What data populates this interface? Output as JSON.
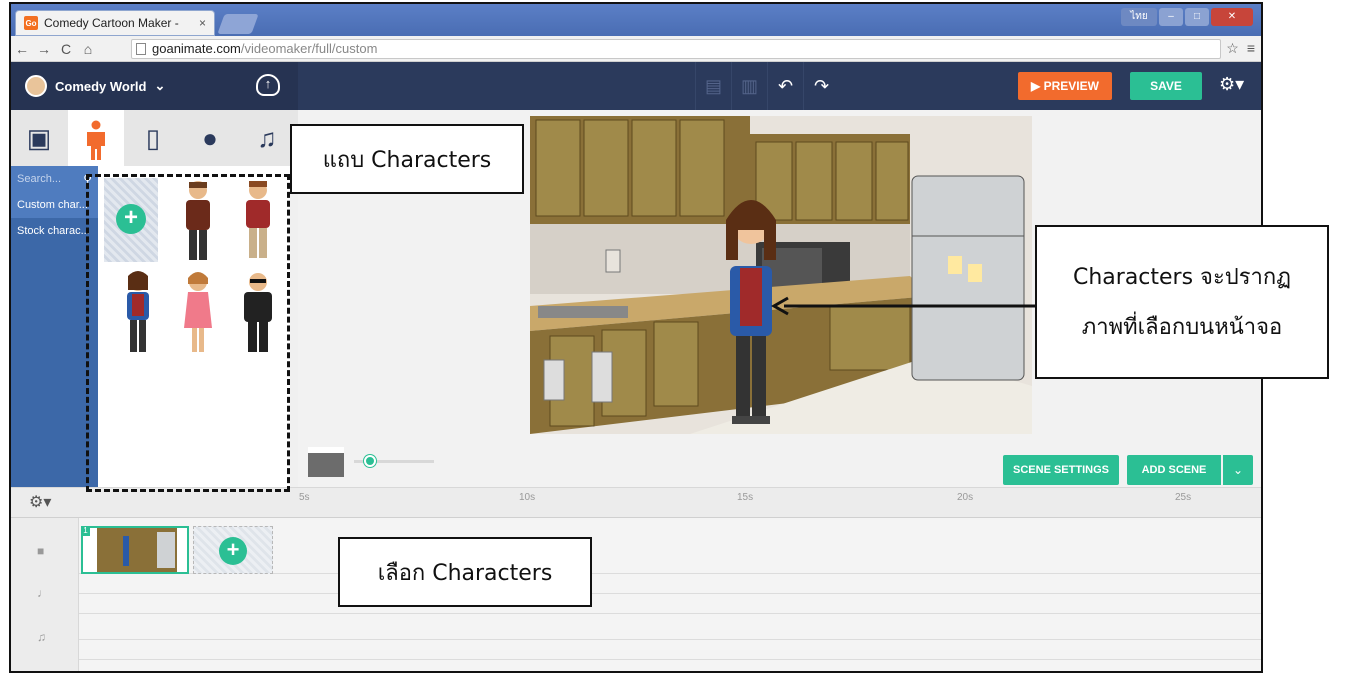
{
  "browser": {
    "tab_title": "Comedy Cartoon Maker -",
    "tab_close": "×",
    "favicon_text": "Go",
    "lang_button": "ไทย",
    "url_host": "goanimate.com",
    "url_path": "/videomaker/full/custom"
  },
  "app": {
    "world_name": "Comedy World",
    "preview_label": "PREVIEW",
    "save_label": "SAVE"
  },
  "sidebar": {
    "search_placeholder": "Search...",
    "items": [
      {
        "label": "Custom char..."
      },
      {
        "label": "Stock charac..."
      }
    ]
  },
  "stage": {
    "scene_settings_label": "SCENE SETTINGS",
    "add_scene_label": "ADD SCENE"
  },
  "timeline": {
    "ticks": [
      "5s",
      "10s",
      "15s",
      "20s",
      "25s"
    ],
    "scene_number": "1"
  },
  "annotations": {
    "tab_callout": "แถบ Characters",
    "display_callout_line1": "Characters จะปรากฏ",
    "display_callout_line2": "ภาพที่เลือกบนหน้าจอ",
    "select_callout": "เลือก Characters"
  },
  "colors": {
    "accent_green": "#2bbf94",
    "accent_orange": "#f26b2d",
    "topbar_navy": "#2b3a5c",
    "sidebar_blue": "#3c68a8"
  },
  "icons": {
    "tabs": [
      "image-icon",
      "character-icon",
      "phone-icon",
      "speech-icon",
      "music-icon"
    ],
    "toolbar": [
      "copy-icon",
      "paste-icon",
      "undo-icon",
      "redo-icon",
      "settings-icon"
    ]
  }
}
